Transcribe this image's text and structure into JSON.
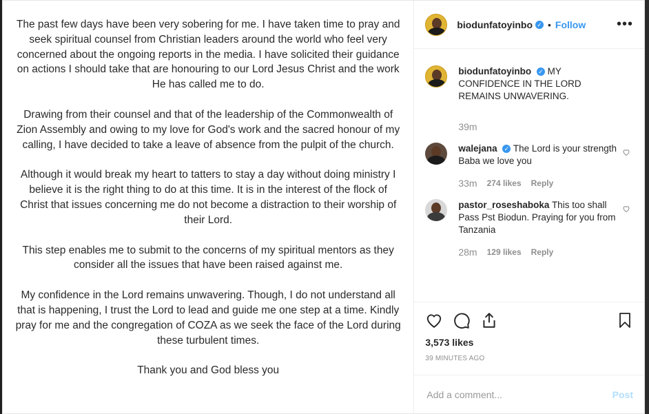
{
  "statement": {
    "paragraphs": [
      "The past few days have been very sobering for me. I have taken time to pray and seek spiritual counsel from Christian leaders around the world who feel very concerned about the ongoing reports in the media. I have solicited their guidance on actions I should take that are honouring to our Lord Jesus Christ and the work He has called me to do.",
      "Drawing from their counsel and that of the leadership of the Commonwealth of Zion Assembly and owing to my love for God's work and the sacred honour of my calling, I have decided to take a leave of absence from the pulpit of the church.",
      "Although it would break my heart to tatters to stay a day without doing ministry I believe it is the right thing to do at this time. It is in the interest of the flock of Christ that issues concerning me do not become a distraction to their worship of their Lord.",
      "This step enables me to submit to the concerns of my spiritual mentors as they consider all the issues that have been raised against me.",
      "My confidence in the Lord remains unwavering. Though, I do not understand all that is happening, I trust the Lord to lead and guide me one step at a time. Kindly pray for me and the congregation of COZA as we seek the face of the Lord during these turbulent times.",
      "Thank you and God bless you"
    ]
  },
  "header": {
    "username": "biodunfatoyinbo",
    "separator": "•",
    "follow_label": "Follow",
    "more_icon": "•••"
  },
  "caption": {
    "username": "biodunfatoyinbo",
    "text": "MY CONFIDENCE IN THE LORD REMAINS UNWAVERING.",
    "time": "39m"
  },
  "comments": [
    {
      "username": "walejana",
      "verified": true,
      "text": "The Lord is your strength Baba we love you",
      "time": "33m",
      "likes": "274 likes",
      "reply": "Reply"
    },
    {
      "username": "pastor_roseshaboka",
      "verified": false,
      "text": "This too shall Pass Pst Biodun. Praying for you from Tanzania",
      "time": "28m",
      "likes": "129 likes",
      "reply": "Reply"
    }
  ],
  "actions": {
    "like_count": "3,573 likes",
    "posted": "39 MINUTES AGO"
  },
  "composer": {
    "placeholder": "Add a comment...",
    "post_label": "Post"
  },
  "colors": {
    "accent": "#3897f0",
    "post_disabled": "#b2dffc",
    "muted": "#8e8e8e"
  }
}
